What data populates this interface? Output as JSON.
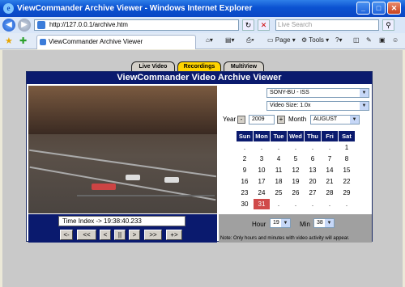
{
  "window": {
    "title": "ViewCommander Archive Viewer - Windows Internet Explorer",
    "min": "_",
    "max": "□",
    "close": "✕"
  },
  "address": {
    "url": "http://127.0.0.1/archive.htm",
    "search_placeholder": "Live Search"
  },
  "tab": {
    "label": "ViewCommander Archive Viewer"
  },
  "tools": {
    "page": "Page",
    "tools": "Tools"
  },
  "page_tabs": [
    {
      "label": "Live Video"
    },
    {
      "label": "Recordings"
    },
    {
      "label": "MultiView"
    }
  ],
  "viewer": {
    "title": "ViewCommander Video Archive Viewer",
    "camera": "SONY-BU - ISS",
    "video_size": "Video Size: 1.0x",
    "year_label": "Year",
    "year": "2009",
    "month_label": "Month",
    "month": "AUGUST",
    "weekdays": [
      "Sun",
      "Mon",
      "Tue",
      "Wed",
      "Thu",
      "Fri",
      "Sat"
    ],
    "weeks": [
      [
        ".",
        ".",
        ".",
        ".",
        ".",
        ".",
        "1"
      ],
      [
        "2",
        "3",
        "4",
        "5",
        "6",
        "7",
        "8"
      ],
      [
        "9",
        "10",
        "11",
        "12",
        "13",
        "14",
        "15"
      ],
      [
        "16",
        "17",
        "18",
        "19",
        "20",
        "21",
        "22"
      ],
      [
        "23",
        "24",
        "25",
        "26",
        "27",
        "28",
        "29"
      ],
      [
        "30",
        "31",
        ".",
        ".",
        ".",
        ".",
        "."
      ]
    ],
    "selected_day": "31",
    "time_index": "Time Index -> 19:38:40.233",
    "playback": [
      "<-",
      "<<",
      "<",
      "||",
      ">",
      ">>",
      "+>"
    ],
    "hour_label": "Hour",
    "hour": "19",
    "min_label": "Min",
    "minute": "38",
    "note": "Note: Only hours and minutes with video activity will appear."
  }
}
